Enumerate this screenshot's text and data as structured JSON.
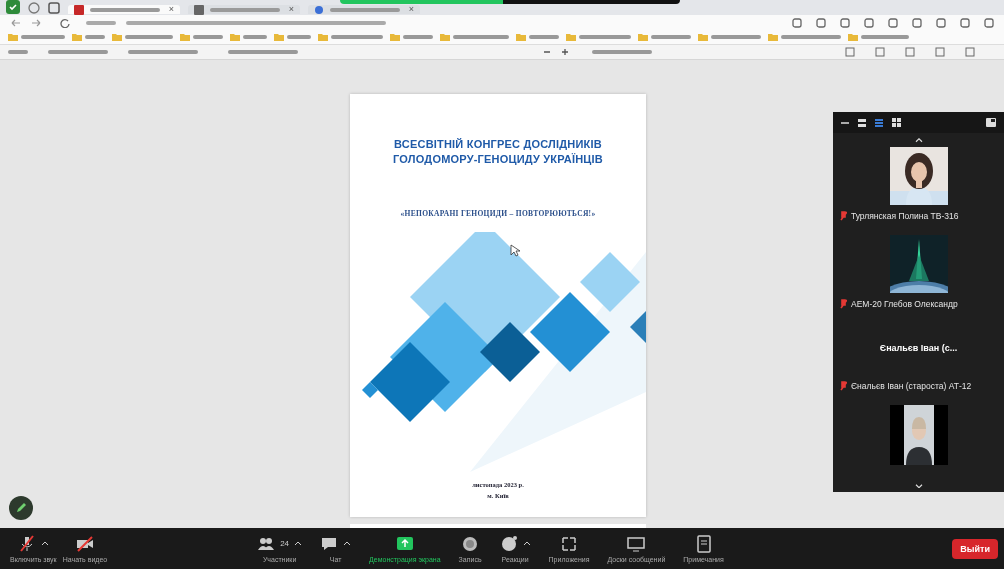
{
  "browser": {
    "tabs": [
      {
        "selected": true,
        "close": "×"
      },
      {
        "selected": false,
        "close": "×"
      },
      {
        "selected": false,
        "close": "×"
      }
    ]
  },
  "document": {
    "title_lines": [
      "ВСЕСВІТНІЙ КОНГРЕС ДОСЛІДНИКІВ",
      "ГОЛОДОМОРУ-ГЕНОЦИДУ УКРАЇНЦІВ"
    ],
    "motto": "«НЕПОКАРАНІ ГЕНОЦИДИ – ПОВТОРЮЮТЬСЯ!»",
    "footer_lines": [
      "листопада 2023 р.",
      "м. Київ"
    ]
  },
  "gallery": {
    "tiles": [
      {
        "kind": "video",
        "name": "Турлянская Полина ТВ-316",
        "muted": true
      },
      {
        "kind": "video",
        "name": "АЕМ-20 Глебов Олександр",
        "muted": true
      },
      {
        "kind": "name",
        "display": "Єнальєв Іван (с...",
        "name": "Єнальєв Іван (староста) АТ-12",
        "muted": true
      },
      {
        "kind": "video"
      }
    ]
  },
  "toolbar": {
    "items": [
      {
        "kind": "mic",
        "label": "Включить звук",
        "caret": true
      },
      {
        "kind": "video",
        "label": "Начать видео",
        "caret": false
      },
      {
        "kind": "participants",
        "label": "Участники",
        "count": "24",
        "caret": true
      },
      {
        "kind": "chat",
        "label": "Чат",
        "caret": true
      },
      {
        "kind": "share",
        "label": "Демонстрация экрана",
        "caret": false,
        "active": true
      },
      {
        "kind": "record",
        "label": "Запись",
        "caret": false
      },
      {
        "kind": "reactions",
        "label": "Реакции",
        "caret": true
      },
      {
        "kind": "apps",
        "label": "Приложения",
        "caret": false
      },
      {
        "kind": "whiteboard",
        "label": "Доски сообщений",
        "caret": false
      },
      {
        "kind": "notes",
        "label": "Примечания",
        "caret": false
      }
    ],
    "leave": "Выйти"
  }
}
